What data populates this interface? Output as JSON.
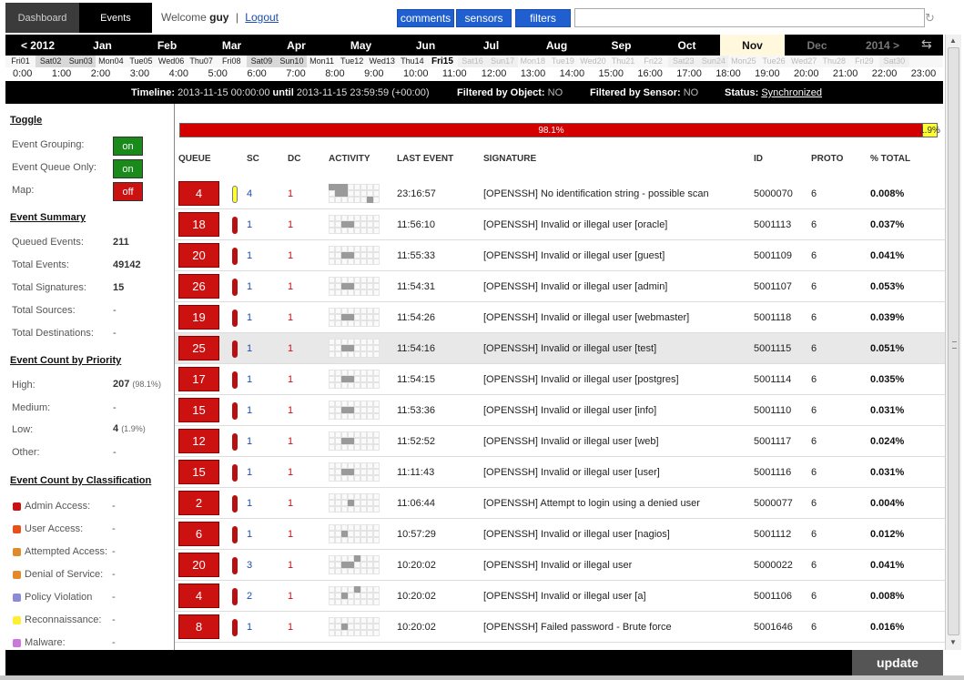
{
  "nav": {
    "dashboard": "Dashboard",
    "events": "Events"
  },
  "welcome": {
    "prefix": "Welcome",
    "user": "guy",
    "separator": "|",
    "logout": "Logout"
  },
  "buttons": {
    "comments": "comments",
    "sensors": "sensors",
    "filters": "filters",
    "update": "update"
  },
  "search": {
    "value": ""
  },
  "months": [
    "< 2012",
    "Jan",
    "Feb",
    "Mar",
    "Apr",
    "May",
    "Jun",
    "Jul",
    "Aug",
    "Sep",
    "Oct",
    "Nov",
    "Dec",
    "2014 >"
  ],
  "selected_month": "Nov",
  "days": [
    "Fri01",
    "Sat02",
    "Sun03",
    "Mon04",
    "Tue05",
    "Wed06",
    "Thu07",
    "Fri08",
    "Sat09",
    "Sun10",
    "Mon11",
    "Tue12",
    "Wed13",
    "Thu14",
    "Fri15",
    "Sat16",
    "Sun17",
    "Mon18",
    "Tue19",
    "Wed20",
    "Thu21",
    "Fri22",
    "Sat23",
    "Sun24",
    "Mon25",
    "Tue26",
    "Wed27",
    "Thu28",
    "Fri29",
    "Sat30"
  ],
  "selected_day": "Fri15",
  "hours": [
    "0:00",
    "1:00",
    "2:00",
    "3:00",
    "4:00",
    "5:00",
    "6:00",
    "7:00",
    "8:00",
    "9:00",
    "10:00",
    "11:00",
    "12:00",
    "13:00",
    "14:00",
    "15:00",
    "16:00",
    "17:00",
    "18:00",
    "19:00",
    "20:00",
    "21:00",
    "22:00",
    "23:00"
  ],
  "timeline": {
    "label": "Timeline:",
    "start": "2013-11-15 00:00:00",
    "until": "until",
    "end": "2013-11-15 23:59:59 (+00:00)",
    "filtered_object_label": "Filtered by Object:",
    "filtered_object": "NO",
    "filtered_sensor_label": "Filtered by Sensor:",
    "filtered_sensor": "NO",
    "status_label": "Status:",
    "status": "Synchronized"
  },
  "sidebar": {
    "toggle_title": "Toggle",
    "toggles": [
      {
        "label": "Event Grouping:",
        "state": "on"
      },
      {
        "label": "Event Queue Only:",
        "state": "on"
      },
      {
        "label": "Map:",
        "state": "off"
      }
    ],
    "summary_title": "Event Summary",
    "summary": [
      {
        "label": "Queued Events:",
        "value": "211"
      },
      {
        "label": "Total Events:",
        "value": "49142"
      },
      {
        "label": "Total Signatures:",
        "value": "15"
      },
      {
        "label": "Total Sources:",
        "value": "-"
      },
      {
        "label": "Total Destinations:",
        "value": "-"
      }
    ],
    "priority_title": "Event Count by Priority",
    "priority": [
      {
        "label": "High:",
        "value": "207",
        "pct": "(98.1%)"
      },
      {
        "label": "Medium:",
        "value": "-",
        "pct": ""
      },
      {
        "label": "Low:",
        "value": "4",
        "pct": "(1.9%)"
      },
      {
        "label": "Other:",
        "value": "-",
        "pct": ""
      }
    ],
    "classification_title": "Event Count by Classification",
    "classifications": [
      {
        "label": "Admin Access:",
        "value": "-",
        "color": "#cc1111"
      },
      {
        "label": "User Access:",
        "value": "-",
        "color": "#e8501a"
      },
      {
        "label": "Attempted Access:",
        "value": "-",
        "color": "#e08a2a"
      },
      {
        "label": "Denial of Service:",
        "value": "-",
        "color": "#e08a2a"
      },
      {
        "label": "Policy Violation",
        "value": "-",
        "color": "#8a8ad8"
      },
      {
        "label": "Reconnaissance:",
        "value": "-",
        "color": "#ffee33"
      },
      {
        "label": "Malware:",
        "value": "-",
        "color": "#cc77dd"
      }
    ]
  },
  "priority_bar": {
    "high_pct": "98.1%",
    "low_pct": "1.9%",
    "high_fraction": 0.981
  },
  "table": {
    "headers": {
      "queue": "QUEUE",
      "sc": "SC",
      "dc": "DC",
      "activity": "ACTIVITY",
      "last_event": "LAST EVENT",
      "signature": "SIGNATURE",
      "id": "ID",
      "proto": "PROTO",
      "total": "% TOTAL"
    },
    "rows": [
      {
        "queue": "4",
        "priority": "low",
        "sc": "4",
        "dc": "1",
        "activity": [
          0,
          1,
          2,
          9,
          10,
          22
        ],
        "last": "23:16:57",
        "signature": "[OPENSSH] No identification string - possible scan",
        "id": "5000070",
        "proto": "6",
        "total": "0.008%"
      },
      {
        "queue": "18",
        "priority": "high",
        "sc": "1",
        "dc": "1",
        "activity": [
          10,
          11
        ],
        "last": "11:56:10",
        "signature": "[OPENSSH] Invalid or illegal user [oracle]",
        "id": "5001113",
        "proto": "6",
        "total": "0.037%"
      },
      {
        "queue": "20",
        "priority": "high",
        "sc": "1",
        "dc": "1",
        "activity": [
          10,
          11
        ],
        "last": "11:55:33",
        "signature": "[OPENSSH] Invalid or illegal user [guest]",
        "id": "5001109",
        "proto": "6",
        "total": "0.041%"
      },
      {
        "queue": "26",
        "priority": "high",
        "sc": "1",
        "dc": "1",
        "activity": [
          10,
          11
        ],
        "last": "11:54:31",
        "signature": "[OPENSSH] Invalid or illegal user [admin]",
        "id": "5001107",
        "proto": "6",
        "total": "0.053%"
      },
      {
        "queue": "19",
        "priority": "high",
        "sc": "1",
        "dc": "1",
        "activity": [
          10,
          11
        ],
        "last": "11:54:26",
        "signature": "[OPENSSH] Invalid or illegal user [webmaster]",
        "id": "5001118",
        "proto": "6",
        "total": "0.039%"
      },
      {
        "queue": "25",
        "priority": "high",
        "sc": "1",
        "dc": "1",
        "activity": [
          10,
          11
        ],
        "last": "11:54:16",
        "signature": "[OPENSSH] Invalid or illegal user [test]",
        "id": "5001115",
        "proto": "6",
        "total": "0.051%",
        "highlight": true
      },
      {
        "queue": "17",
        "priority": "high",
        "sc": "1",
        "dc": "1",
        "activity": [
          10,
          11
        ],
        "last": "11:54:15",
        "signature": "[OPENSSH] Invalid or illegal user [postgres]",
        "id": "5001114",
        "proto": "6",
        "total": "0.035%"
      },
      {
        "queue": "15",
        "priority": "high",
        "sc": "1",
        "dc": "1",
        "activity": [
          10,
          11
        ],
        "last": "11:53:36",
        "signature": "[OPENSSH] Invalid or illegal user [info]",
        "id": "5001110",
        "proto": "6",
        "total": "0.031%"
      },
      {
        "queue": "12",
        "priority": "high",
        "sc": "1",
        "dc": "1",
        "activity": [
          10,
          11
        ],
        "last": "11:52:52",
        "signature": "[OPENSSH] Invalid or illegal user [web]",
        "id": "5001117",
        "proto": "6",
        "total": "0.024%"
      },
      {
        "queue": "15",
        "priority": "high",
        "sc": "1",
        "dc": "1",
        "activity": [
          10,
          11
        ],
        "last": "11:11:43",
        "signature": "[OPENSSH] Invalid or illegal user [user]",
        "id": "5001116",
        "proto": "6",
        "total": "0.031%"
      },
      {
        "queue": "2",
        "priority": "high",
        "sc": "1",
        "dc": "1",
        "activity": [
          11
        ],
        "last": "11:06:44",
        "signature": "[OPENSSH] Attempt to login using a denied user",
        "id": "5000077",
        "proto": "6",
        "total": "0.004%"
      },
      {
        "queue": "6",
        "priority": "high",
        "sc": "1",
        "dc": "1",
        "activity": [
          10
        ],
        "last": "10:57:29",
        "signature": "[OPENSSH] Invalid or illegal user [nagios]",
        "id": "5001112",
        "proto": "6",
        "total": "0.012%"
      },
      {
        "queue": "20",
        "priority": "high",
        "sc": "3",
        "dc": "1",
        "activity": [
          4,
          10,
          11
        ],
        "last": "10:20:02",
        "signature": "[OPENSSH] Invalid or illegal user",
        "id": "5000022",
        "proto": "6",
        "total": "0.041%"
      },
      {
        "queue": "4",
        "priority": "high",
        "sc": "2",
        "dc": "1",
        "activity": [
          4,
          10
        ],
        "last": "10:20:02",
        "signature": "[OPENSSH] Invalid or illegal user [a]",
        "id": "5001106",
        "proto": "6",
        "total": "0.008%"
      },
      {
        "queue": "8",
        "priority": "high",
        "sc": "1",
        "dc": "1",
        "activity": [
          10
        ],
        "last": "10:20:02",
        "signature": "[OPENSSH] Failed password - Brute force",
        "id": "5001646",
        "proto": "6",
        "total": "0.016%"
      }
    ]
  }
}
